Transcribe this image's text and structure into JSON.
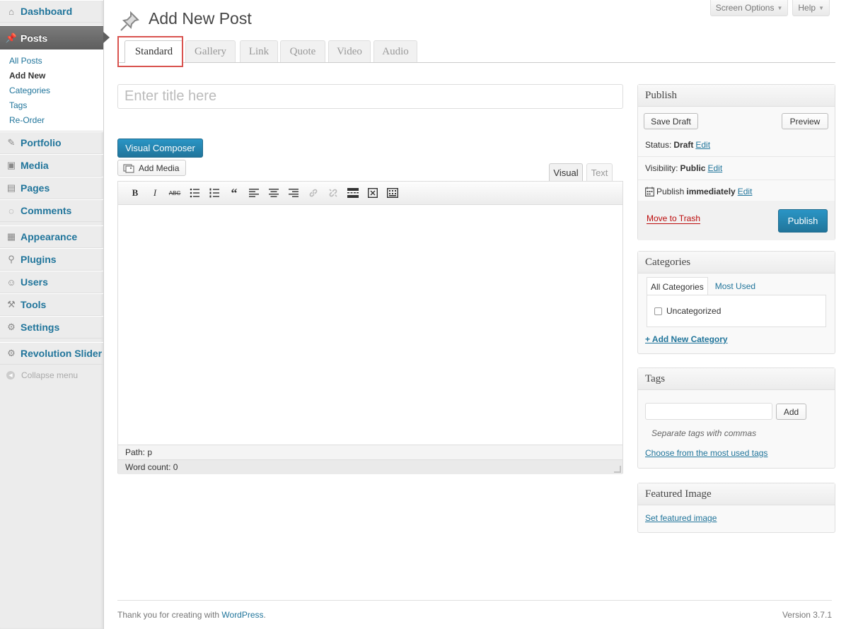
{
  "sidebar": {
    "dashboard": "Dashboard",
    "posts": "Posts",
    "posts_sub": [
      "All Posts",
      "Add New",
      "Categories",
      "Tags",
      "Re-Order"
    ],
    "portfolio": "Portfolio",
    "media": "Media",
    "pages": "Pages",
    "comments": "Comments",
    "appearance": "Appearance",
    "plugins": "Plugins",
    "users": "Users",
    "tools": "Tools",
    "settings": "Settings",
    "revolution_slider": "Revolution Slider",
    "collapse": "Collapse menu"
  },
  "header": {
    "title": "Add New Post",
    "screen_options": "Screen Options",
    "help": "Help"
  },
  "format_tabs": [
    "Standard",
    "Gallery",
    "Link",
    "Quote",
    "Video",
    "Audio"
  ],
  "editor": {
    "title_placeholder": "Enter title here",
    "visual_composer": "Visual Composer",
    "add_media": "Add Media",
    "tab_visual": "Visual",
    "tab_text": "Text",
    "path": "Path: p",
    "word_count": "Word count: 0"
  },
  "publish": {
    "heading": "Publish",
    "save_draft": "Save Draft",
    "preview": "Preview",
    "status_label": "Status:",
    "status_value": "Draft",
    "visibility_label": "Visibility:",
    "visibility_value": "Public",
    "publish_label": "Publish",
    "publish_value": "immediately",
    "edit": "Edit",
    "move_to_trash": "Move to Trash",
    "publish_button": "Publish"
  },
  "categories": {
    "heading": "Categories",
    "tab_all": "All Categories",
    "tab_most_used": "Most Used",
    "items": [
      "Uncategorized"
    ],
    "add_new": "+ Add New Category"
  },
  "tags": {
    "heading": "Tags",
    "add": "Add",
    "hint": "Separate tags with commas",
    "choose": "Choose from the most used tags"
  },
  "featured_image": {
    "heading": "Featured Image",
    "set": "Set featured image"
  },
  "footer": {
    "thanks_prefix": "Thank you for creating with ",
    "wordpress": "WordPress",
    "thanks_suffix": ".",
    "version": "Version 3.7.1"
  },
  "colors": {
    "link": "#21759b",
    "primary_button": "#21759b",
    "trash": "#bc0b0b",
    "highlight_box": "#d9534f"
  }
}
